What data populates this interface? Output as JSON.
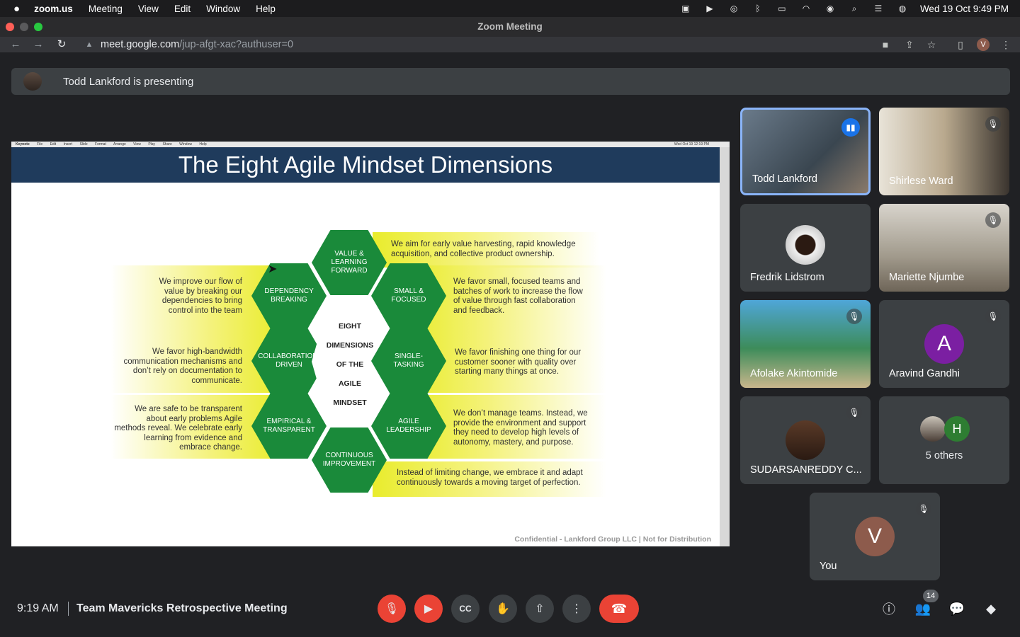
{
  "menubar": {
    "app": "zoom.us",
    "items": [
      "Meeting",
      "View",
      "Edit",
      "Window",
      "Help"
    ],
    "datetime": "Wed 19 Oct  9:49 PM"
  },
  "window": {
    "title": "Zoom Meeting"
  },
  "browser": {
    "url_host": "meet.google.com",
    "url_path": "/jup-afgt-xac?authuser=0",
    "profile_initial": "V"
  },
  "meet": {
    "presenting_banner": "Todd Lankford is presenting",
    "slide": {
      "title": "The Eight Agile Mindset Dimensions",
      "mini_menubar": [
        "Keynote",
        "File",
        "Edit",
        "Insert",
        "Slide",
        "Format",
        "Arrange",
        "View",
        "Play",
        "Share",
        "Window",
        "Help"
      ],
      "mini_clock": "Wed Oct 19 12:19 PM",
      "center_lines": [
        "EIGHT",
        "DIMENSIONS",
        "OF THE",
        "AGILE",
        "MINDSET"
      ],
      "hexes": {
        "value_learning": "VALUE & LEARNING FORWARD",
        "dependency": "DEPENDENCY BREAKING",
        "small_focused": "SMALL & FOCUSED",
        "collaboration": "COLLABORATION-DRIVEN",
        "single_tasking": "SINGLE-TASKING",
        "empirical": "EMPIRICAL & TRANSPARENT",
        "agile_leadership": "AGILE LEADERSHIP",
        "continuous": "CONTINUOUS IMPROVEMENT"
      },
      "descriptions": {
        "value_learning": "We aim for early value harvesting, rapid knowledge acquisition, and collective product ownership.",
        "dependency": "We improve our flow of value by breaking our dependencies to bring control into the team",
        "small_focused": "We favor small, focused teams and batches of work to increase the flow of value through fast collaboration and feedback.",
        "collaboration": "We favor high-bandwidth communication mechanisms and don’t rely on documentation to communicate.",
        "single_tasking": "We favor finishing one thing for our customer sooner with quality over starting many things at once.",
        "empirical": "We are safe to be transparent about early problems Agile methods reveal. We celebrate early learning from evidence and embrace change.",
        "agile_leadership": "We don’t manage teams. Instead, we provide the environment and support they need to develop high levels of autonomy, mastery, and purpose.",
        "continuous": "Instead of limiting change, we embrace it and adapt continuously towards a moving target of perfection."
      },
      "footer": "Confidential - Lankford Group LLC | Not for Distribution"
    },
    "participants": [
      {
        "name": "Todd Lankford"
      },
      {
        "name": "Shirlese Ward"
      },
      {
        "name": "Fredrik Lidstrom"
      },
      {
        "name": "Mariette Njumbe"
      },
      {
        "name": "Afolake Akintomide"
      },
      {
        "name": "Aravind Gandhi",
        "initial": "A",
        "color": "#7b1fa2"
      },
      {
        "name": "SUDARSANREDDY C..."
      },
      {
        "name": "5 others",
        "extra_initial": "H",
        "extra_color": "#2e7d32"
      },
      {
        "name": "You",
        "initial": "V",
        "color": "#8d5b4c"
      }
    ],
    "bottom": {
      "time": "9:19 AM",
      "meeting_title": "Team Mavericks Retrospective Meeting",
      "people_count": "14"
    }
  },
  "colors": {
    "meet_bg": "#202124",
    "control_bg": "#3c4043",
    "end_call": "#ea4335",
    "hex_green": "#1a8a3a",
    "slide_title_bar": "#1f3b5c"
  }
}
